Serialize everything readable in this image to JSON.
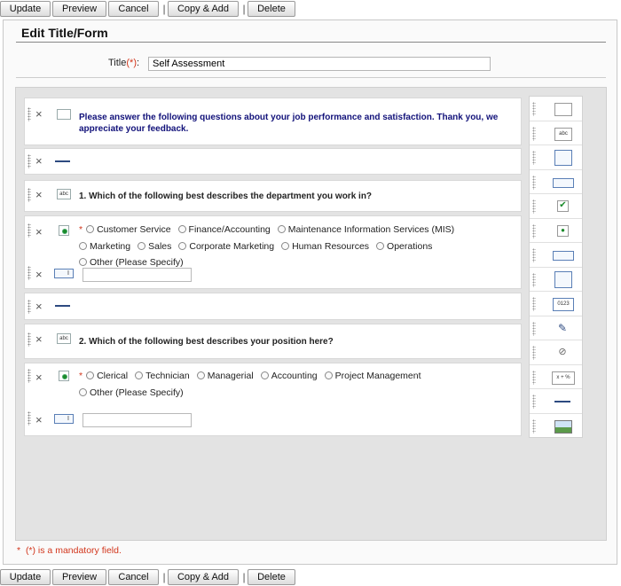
{
  "toolbar": {
    "update": "Update",
    "preview": "Preview",
    "cancel": "Cancel",
    "separator": "|",
    "copy_add": "Copy & Add",
    "delete": "Delete"
  },
  "page_title": "Edit Title/Form",
  "title_field": {
    "label": "Title",
    "required_marker": "(*)",
    "colon": ":",
    "value": "Self Assessment"
  },
  "form": {
    "intro_text": "Please answer the following questions about your job performance and satisfaction. Thank you, we appreciate your feedback.",
    "question1": {
      "text": "1. Which of the following best describes the department you work in?",
      "required": "*",
      "options": [
        "Customer Service",
        "Finance/Accounting",
        "Maintenance Information Services (MIS)",
        "Marketing",
        "Sales",
        "Corporate Marketing",
        "Human Resources",
        "Operations",
        "Other (Please Specify)"
      ]
    },
    "question2": {
      "text": "2. Which of the following best describes your position here?",
      "required": "*",
      "options": [
        "Clerical",
        "Technician",
        "Managerial",
        "Accounting",
        "Project Management",
        "Other (Please Specify)"
      ]
    },
    "row_icons": {
      "intro": "rich-text-icon",
      "separator": "separator-line-icon",
      "question_label": "text-label-icon",
      "radio_group": "radio-button-icon",
      "textbox": "textbox-icon",
      "delete": "close-icon"
    },
    "delete_glyph": "×",
    "abc_label": "abc"
  },
  "palette": {
    "items": [
      {
        "icon": "rich-text-icon"
      },
      {
        "icon": "text-label-icon",
        "label": "abc"
      },
      {
        "icon": "text-area-icon"
      },
      {
        "icon": "textbox-icon"
      },
      {
        "icon": "checkbox-icon"
      },
      {
        "icon": "radio-button-icon"
      },
      {
        "icon": "dropdown-icon"
      },
      {
        "icon": "list-box-icon"
      },
      {
        "icon": "number-field-icon",
        "label": "0123"
      },
      {
        "icon": "notes-edit-icon"
      },
      {
        "icon": "attachment-icon"
      },
      {
        "icon": "calculation-icon",
        "label": "x + %"
      },
      {
        "icon": "separator-line-icon"
      },
      {
        "icon": "image-icon"
      }
    ]
  },
  "footnote": {
    "star": "*",
    "text": "(*) is a mandatory field."
  },
  "colors": {
    "required": "#d2361c",
    "intro_text": "#12127a",
    "canvas_bg": "#e3e3e3"
  }
}
